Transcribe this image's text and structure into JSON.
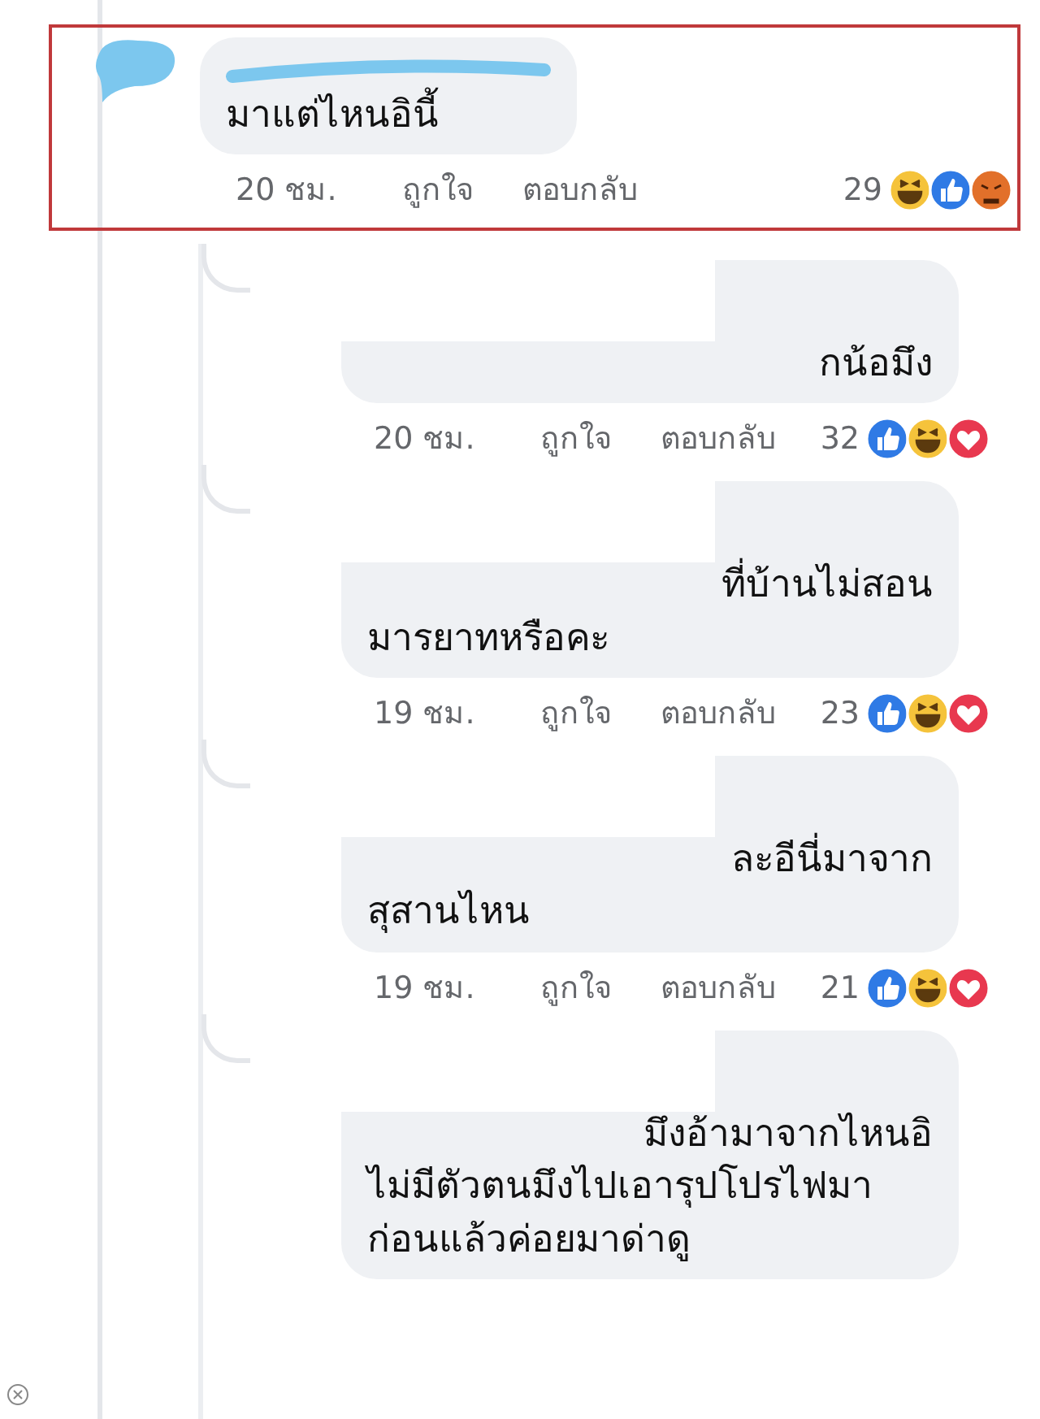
{
  "comments": [
    {
      "kind": "comment",
      "lines": [
        "มาแต่ไหนอินี้"
      ],
      "name_hidden": true,
      "highlighted": true,
      "time": "20 ชม.",
      "like": "ถูกใจ",
      "reply": "ตอบกลับ",
      "count": "29",
      "reactions": [
        {
          "kind": "haha"
        },
        {
          "kind": "like"
        },
        {
          "kind": "angry"
        }
      ]
    },
    {
      "kind": "reply",
      "lines": [
        "กน้อมึง"
      ],
      "name_hidden": true,
      "highlighted": false,
      "time": "20 ชม.",
      "like": "ถูกใจ",
      "reply": "ตอบกลับ",
      "count": "32",
      "reactions": [
        {
          "kind": "like"
        },
        {
          "kind": "haha"
        },
        {
          "kind": "love"
        }
      ]
    },
    {
      "kind": "reply",
      "lines": [
        "ที่บ้านไม่สอน",
        "มารยาทหรือคะ"
      ],
      "name_hidden": true,
      "highlighted": false,
      "time": "19 ชม.",
      "like": "ถูกใจ",
      "reply": "ตอบกลับ",
      "count": "23",
      "reactions": [
        {
          "kind": "like"
        },
        {
          "kind": "haha"
        },
        {
          "kind": "love"
        }
      ]
    },
    {
      "kind": "reply",
      "lines": [
        "ละอีนี่มาจาก",
        "สุสานไหน"
      ],
      "name_hidden": true,
      "highlighted": false,
      "time": "19 ชม.",
      "like": "ถูกใจ",
      "reply": "ตอบกลับ",
      "count": "21",
      "reactions": [
        {
          "kind": "like"
        },
        {
          "kind": "haha"
        },
        {
          "kind": "love"
        }
      ]
    },
    {
      "kind": "reply",
      "lines": [
        "มึงอ้ามาจากไหนอิ",
        "ไม่มีตัวตนมึงไปเอารุปโปรไฟมา",
        "ก่อนแล้วค่อยมาด่าดู"
      ],
      "name_hidden": true,
      "highlighted": false
    }
  ]
}
